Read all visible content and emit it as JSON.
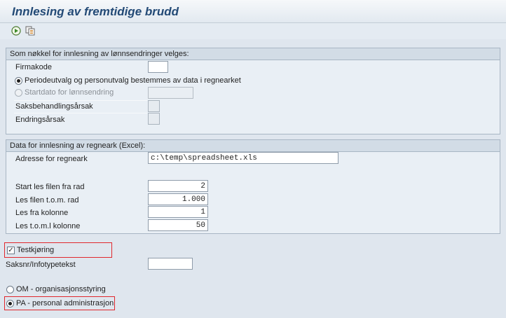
{
  "title": "Innlesing av fremtidige brudd",
  "toolbar": {
    "icons": [
      "execute-icon",
      "variants-icon"
    ]
  },
  "group1": {
    "title": "Som nøkkel for innlesning av lønnsendringer velges:",
    "firmakode_label": "Firmakode",
    "firmakode_value": "",
    "radio_period_label": "Periodeutvalg og personutvalg bestemmes av data i regnearket",
    "radio_period_selected": true,
    "radio_start_label": "Startdato for lønnsendring",
    "radio_start_value": "",
    "saksbeh_label": "Saksbehandlingsårsak",
    "endring_label": "Endringsårsak"
  },
  "group2": {
    "title": "Data for innlesning av regneark (Excel):",
    "adresse_label": "Adresse for regneark",
    "adresse_value": "c:\\temp\\spreadsheet.xls",
    "start_label": "Start les filen fra rad",
    "start_value": "2",
    "til_rad_label": "Les filen t.o.m. rad",
    "til_rad_value": "1.000",
    "fra_kol_label": "Les fra kolonne",
    "fra_kol_value": "1",
    "til_kol_label": "Les t.o.m.l kolonne",
    "til_kol_value": "50"
  },
  "testkjoring": {
    "label": "Testkjøring",
    "checked": true,
    "mark": "✓"
  },
  "saksnr": {
    "label": "Saksnr/Infotypetekst",
    "value": ""
  },
  "system_choice": {
    "om_label": "OM - organisasjonsstyring",
    "pa_label": "PA - personal administrasjon",
    "selected": "PA"
  },
  "colors": {
    "highlight": "#e0282d",
    "title": "#234a76"
  }
}
